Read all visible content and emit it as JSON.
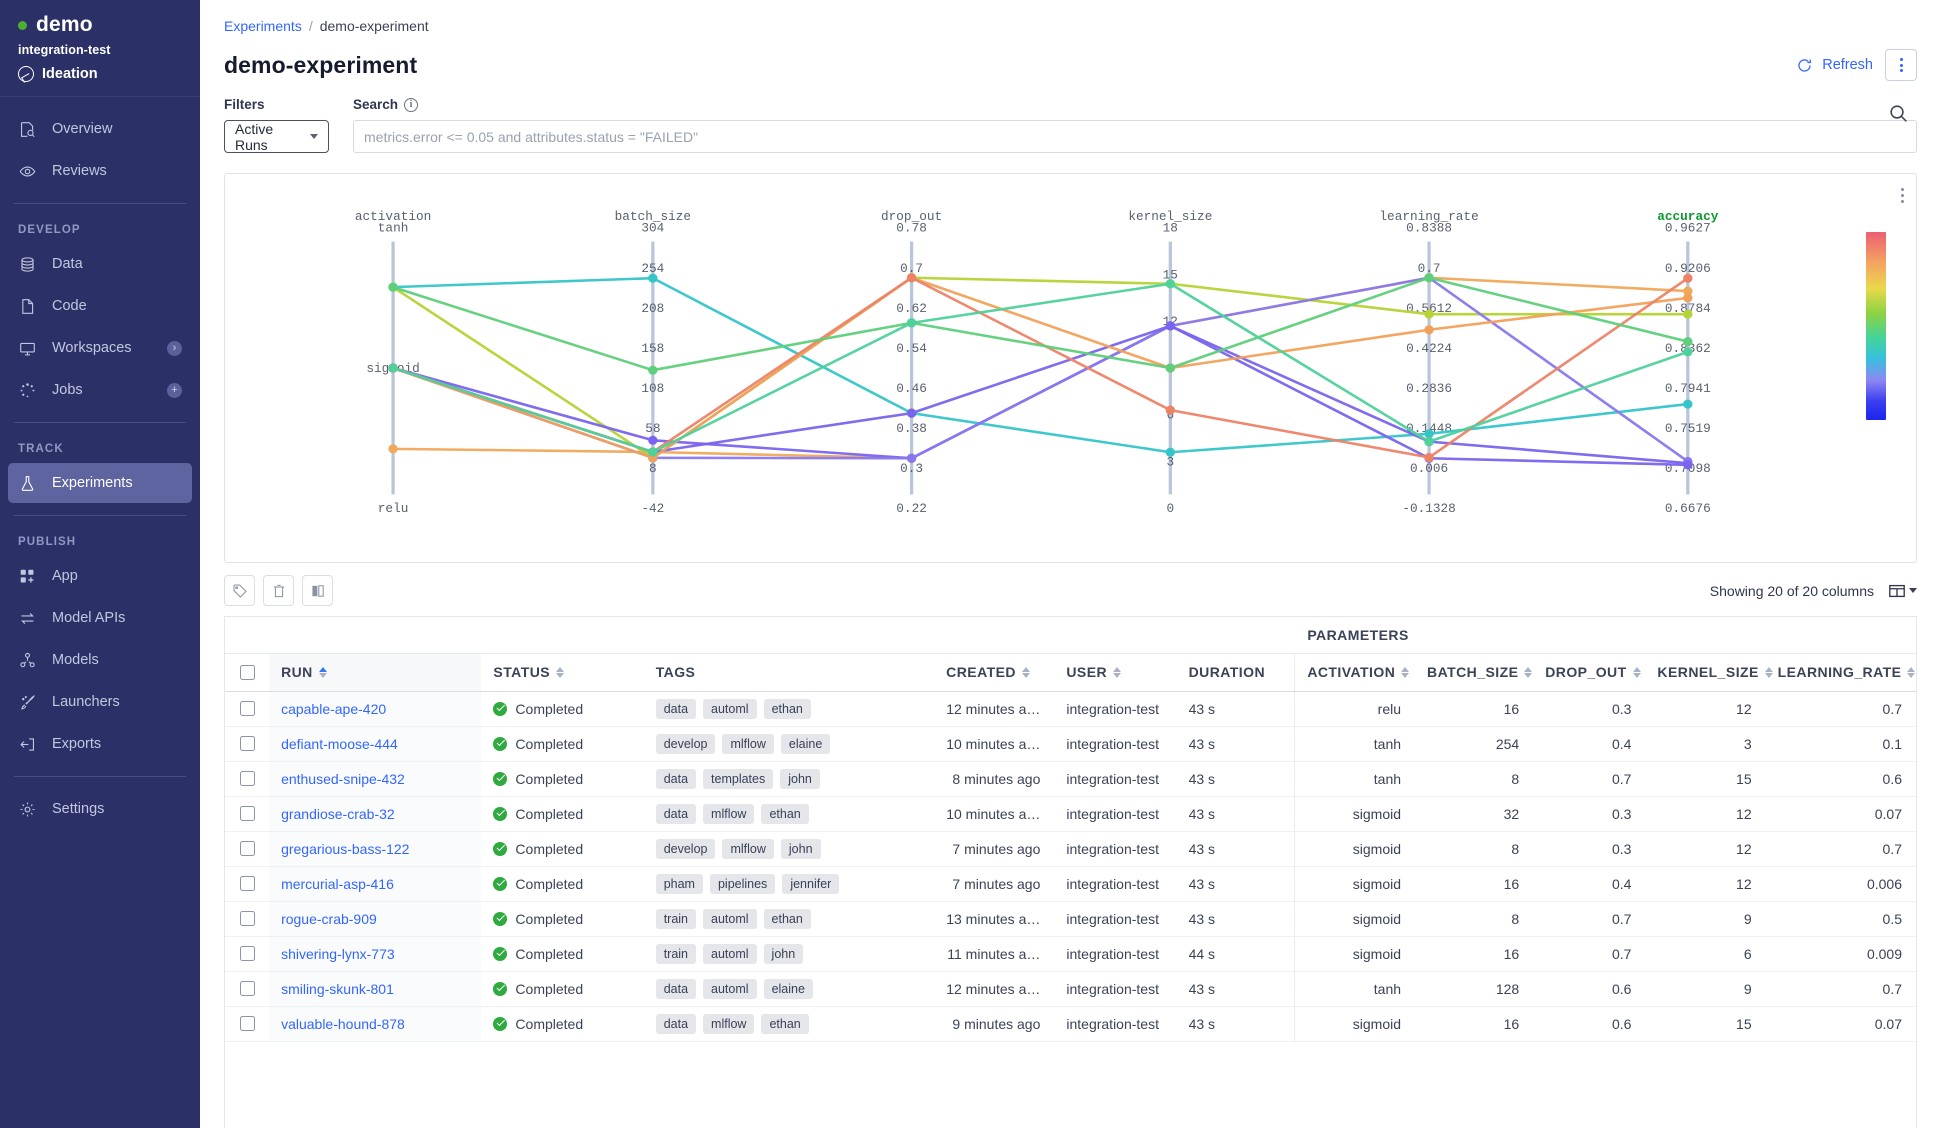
{
  "sidebar": {
    "org_name": "demo",
    "org_sub": "integration-test",
    "project_name": "Ideation",
    "top_items": [
      {
        "label": "Overview",
        "icon": "overview-icon"
      },
      {
        "label": "Reviews",
        "icon": "eye-icon"
      }
    ],
    "sections": [
      {
        "heading": "DEVELOP",
        "items": [
          {
            "label": "Data",
            "icon": "database-icon",
            "badge": ""
          },
          {
            "label": "Code",
            "icon": "file-icon",
            "badge": ""
          },
          {
            "label": "Workspaces",
            "icon": "monitor-icon",
            "badge": "›"
          },
          {
            "label": "Jobs",
            "icon": "spinner-icon",
            "badge": "+"
          }
        ]
      },
      {
        "heading": "TRACK",
        "items": [
          {
            "label": "Experiments",
            "icon": "flask-icon",
            "badge": "",
            "active": true
          }
        ]
      },
      {
        "heading": "PUBLISH",
        "items": [
          {
            "label": "App",
            "icon": "apps-icon",
            "badge": ""
          },
          {
            "label": "Model APIs",
            "icon": "exchange-icon",
            "badge": ""
          },
          {
            "label": "Models",
            "icon": "model-icon",
            "badge": ""
          },
          {
            "label": "Launchers",
            "icon": "rocket-icon",
            "badge": ""
          },
          {
            "label": "Exports",
            "icon": "export-icon",
            "badge": ""
          }
        ]
      }
    ],
    "footer_items": [
      {
        "label": "Settings",
        "icon": "gear-icon"
      }
    ]
  },
  "header": {
    "breadcrumb_root": "Experiments",
    "breadcrumb_sep": "/",
    "breadcrumb_current": "demo-experiment",
    "page_title": "demo-experiment",
    "refresh_label": "Refresh"
  },
  "filters": {
    "filters_label": "Filters",
    "active_filter": "Active Runs",
    "search_label": "Search",
    "search_value": "",
    "search_placeholder": "metrics.error <= 0.05 and attributes.status = \"FAILED\""
  },
  "toolbar": {
    "showing_label": "Showing 20 of 20 columns"
  },
  "table": {
    "group_header": "PARAMETERS",
    "columns": [
      {
        "key": "run",
        "label": "RUN",
        "sortable": true,
        "sorted": true
      },
      {
        "key": "status",
        "label": "STATUS",
        "sortable": true
      },
      {
        "key": "tags",
        "label": "TAGS",
        "sortable": false
      },
      {
        "key": "created",
        "label": "CREATED",
        "sortable": true
      },
      {
        "key": "user",
        "label": "USER",
        "sortable": true
      },
      {
        "key": "duration",
        "label": "DURATION",
        "sortable": false
      },
      {
        "key": "activation",
        "label": "ACTIVATION",
        "sortable": true
      },
      {
        "key": "batch_size",
        "label": "BATCH_SIZE",
        "sortable": true
      },
      {
        "key": "drop_out",
        "label": "DROP_OUT",
        "sortable": true
      },
      {
        "key": "kernel_size",
        "label": "KERNEL_SIZE",
        "sortable": true
      },
      {
        "key": "learning_rate",
        "label": "LEARNING_RATE",
        "sortable": true
      }
    ],
    "rows": [
      {
        "run": "capable-ape-420",
        "status": "Completed",
        "tags": [
          "data",
          "automl",
          "ethan"
        ],
        "created": "12 minutes a…",
        "user": "integration-test",
        "duration": "43 s",
        "activation": "relu",
        "batch_size": "16",
        "drop_out": "0.3",
        "kernel_size": "12",
        "learning_rate": "0.7"
      },
      {
        "run": "defiant-moose-444",
        "status": "Completed",
        "tags": [
          "develop",
          "mlflow",
          "elaine"
        ],
        "created": "10 minutes a…",
        "user": "integration-test",
        "duration": "43 s",
        "activation": "tanh",
        "batch_size": "254",
        "drop_out": "0.4",
        "kernel_size": "3",
        "learning_rate": "0.1"
      },
      {
        "run": "enthused-snipe-432",
        "status": "Completed",
        "tags": [
          "data",
          "templates",
          "john"
        ],
        "created": "8 minutes ago",
        "user": "integration-test",
        "duration": "43 s",
        "activation": "tanh",
        "batch_size": "8",
        "drop_out": "0.7",
        "kernel_size": "15",
        "learning_rate": "0.6"
      },
      {
        "run": "grandiose-crab-32",
        "status": "Completed",
        "tags": [
          "data",
          "mlflow",
          "ethan"
        ],
        "created": "10 minutes a…",
        "user": "integration-test",
        "duration": "43 s",
        "activation": "sigmoid",
        "batch_size": "32",
        "drop_out": "0.3",
        "kernel_size": "12",
        "learning_rate": "0.07"
      },
      {
        "run": "gregarious-bass-122",
        "status": "Completed",
        "tags": [
          "develop",
          "mlflow",
          "john"
        ],
        "created": "7 minutes ago",
        "user": "integration-test",
        "duration": "43 s",
        "activation": "sigmoid",
        "batch_size": "8",
        "drop_out": "0.3",
        "kernel_size": "12",
        "learning_rate": "0.7"
      },
      {
        "run": "mercurial-asp-416",
        "status": "Completed",
        "tags": [
          "pham",
          "pipelines",
          "jennifer"
        ],
        "created": "7 minutes ago",
        "user": "integration-test",
        "duration": "43 s",
        "activation": "sigmoid",
        "batch_size": "16",
        "drop_out": "0.4",
        "kernel_size": "12",
        "learning_rate": "0.006"
      },
      {
        "run": "rogue-crab-909",
        "status": "Completed",
        "tags": [
          "train",
          "automl",
          "ethan"
        ],
        "created": "13 minutes a…",
        "user": "integration-test",
        "duration": "43 s",
        "activation": "sigmoid",
        "batch_size": "8",
        "drop_out": "0.7",
        "kernel_size": "9",
        "learning_rate": "0.5"
      },
      {
        "run": "shivering-lynx-773",
        "status": "Completed",
        "tags": [
          "train",
          "automl",
          "john"
        ],
        "created": "11 minutes a…",
        "user": "integration-test",
        "duration": "44 s",
        "activation": "sigmoid",
        "batch_size": "16",
        "drop_out": "0.7",
        "kernel_size": "6",
        "learning_rate": "0.009"
      },
      {
        "run": "smiling-skunk-801",
        "status": "Completed",
        "tags": [
          "data",
          "automl",
          "elaine"
        ],
        "created": "12 minutes a…",
        "user": "integration-test",
        "duration": "43 s",
        "activation": "tanh",
        "batch_size": "128",
        "drop_out": "0.6",
        "kernel_size": "9",
        "learning_rate": "0.7"
      },
      {
        "run": "valuable-hound-878",
        "status": "Completed",
        "tags": [
          "data",
          "mlflow",
          "ethan"
        ],
        "created": "9 minutes ago",
        "user": "integration-test",
        "duration": "43 s",
        "activation": "sigmoid",
        "batch_size": "16",
        "drop_out": "0.6",
        "kernel_size": "15",
        "learning_rate": "0.07"
      }
    ]
  },
  "chart_data": {
    "type": "line",
    "title": "",
    "plot_kind": "parallel-coordinates",
    "color_axis": "accuracy",
    "colorbar": {
      "colors": [
        "#e8596b",
        "#f4a261",
        "#e8d44a",
        "#8fd13f",
        "#3ecf8e",
        "#35c0d8",
        "#8b7ff0",
        "#2222ee"
      ],
      "orientation": "vertical"
    },
    "axes": [
      {
        "name": "activation",
        "type": "categorical",
        "tick_labels": [
          "tanh",
          "sigmoid",
          "relu"
        ],
        "tick_positions": [
          0.82,
          0.5,
          0.18
        ]
      },
      {
        "name": "batch_size",
        "type": "numeric",
        "tick_labels": [
          "304",
          "254",
          "208",
          "158",
          "108",
          "58",
          "8",
          "-42"
        ],
        "range": [
          -42,
          304
        ]
      },
      {
        "name": "drop_out",
        "type": "numeric",
        "tick_labels": [
          "0.78",
          "0.7",
          "0.62",
          "0.54",
          "0.46",
          "0.38",
          "0.3",
          "0.22"
        ],
        "range": [
          0.22,
          0.78
        ]
      },
      {
        "name": "kernel_size",
        "type": "numeric",
        "tick_labels": [
          "18",
          "15",
          "12",
          "9",
          "6",
          "3",
          "0"
        ],
        "range": [
          0,
          18
        ]
      },
      {
        "name": "learning_rate",
        "type": "numeric",
        "tick_labels": [
          "0.8388",
          "0.7",
          "0.5612",
          "0.4224",
          "0.2836",
          "0.1448",
          "0.006",
          "-0.1328"
        ],
        "range": [
          -0.1328,
          0.8388
        ]
      },
      {
        "name": "accuracy",
        "type": "numeric",
        "highlight": true,
        "tick_labels": [
          "0.9627",
          "0.9206",
          "0.8784",
          "0.8362",
          "0.7941",
          "0.7519",
          "0.7098",
          "0.6676"
        ],
        "range": [
          0.6676,
          0.9627
        ]
      }
    ],
    "series": [
      {
        "name": "capable-ape-420",
        "color": "#f0a85a",
        "values": {
          "activation": "relu",
          "batch_size": 16,
          "drop_out": 0.3,
          "kernel_size": 12,
          "learning_rate": 0.7,
          "accuracy": 0.905
        }
      },
      {
        "name": "defiant-moose-444",
        "color": "#35c5c9",
        "values": {
          "activation": "tanh",
          "batch_size": 254,
          "drop_out": 0.4,
          "kernel_size": 3,
          "learning_rate": 0.1,
          "accuracy": 0.773
        }
      },
      {
        "name": "enthused-snipe-432",
        "color": "#b5d334",
        "values": {
          "activation": "tanh",
          "batch_size": 8,
          "drop_out": 0.7,
          "kernel_size": 15,
          "learning_rate": 0.56,
          "accuracy": 0.878
        }
      },
      {
        "name": "grandiose-crab-32",
        "color": "#7a63ee",
        "values": {
          "activation": "sigmoid",
          "batch_size": 32,
          "drop_out": 0.3,
          "kernel_size": 12,
          "learning_rate": 0.07,
          "accuracy": 0.704
        }
      },
      {
        "name": "gregarious-bass-122",
        "color": "#8878f0",
        "values": {
          "activation": "sigmoid",
          "batch_size": 8,
          "drop_out": 0.3,
          "kernel_size": 12,
          "learning_rate": 0.7,
          "accuracy": 0.706
        }
      },
      {
        "name": "mercurial-asp-416",
        "color": "#7a63ee",
        "values": {
          "activation": "sigmoid",
          "batch_size": 16,
          "drop_out": 0.4,
          "kernel_size": 12,
          "learning_rate": 0.006,
          "accuracy": 0.702
        }
      },
      {
        "name": "rogue-crab-909",
        "color": "#f2a05a",
        "values": {
          "activation": "sigmoid",
          "batch_size": 8,
          "drop_out": 0.7,
          "kernel_size": 9,
          "learning_rate": 0.5,
          "accuracy": 0.897
        }
      },
      {
        "name": "shivering-lynx-773",
        "color": "#ed8266",
        "values": {
          "activation": "sigmoid",
          "batch_size": 16,
          "drop_out": 0.7,
          "kernel_size": 6,
          "learning_rate": 0.009,
          "accuracy": 0.92
        }
      },
      {
        "name": "smiling-skunk-801",
        "color": "#5ecf7a",
        "values": {
          "activation": "tanh",
          "batch_size": 128,
          "drop_out": 0.6,
          "kernel_size": 9,
          "learning_rate": 0.7,
          "accuracy": 0.846
        }
      },
      {
        "name": "valuable-hound-878",
        "color": "#4ed19a",
        "values": {
          "activation": "sigmoid",
          "batch_size": 16,
          "drop_out": 0.6,
          "kernel_size": 15,
          "learning_rate": 0.07,
          "accuracy": 0.834
        }
      }
    ]
  }
}
